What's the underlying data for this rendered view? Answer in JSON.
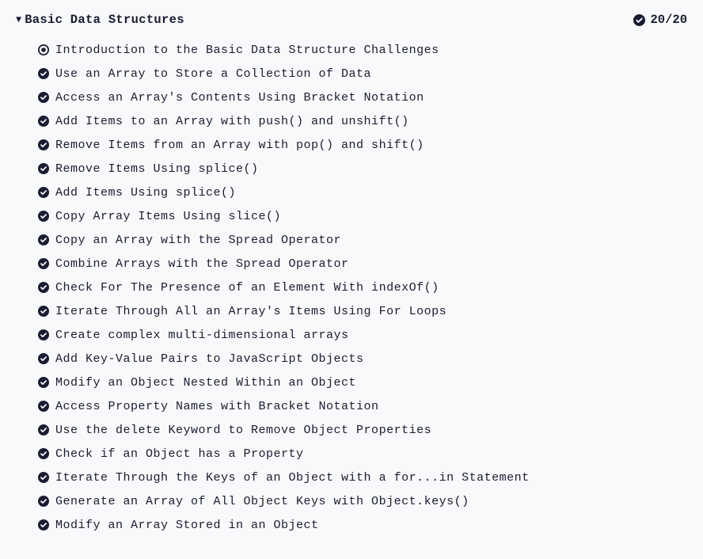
{
  "section": {
    "title": "Basic Data Structures",
    "progress": "20/20",
    "caret": "▼",
    "challenges": [
      {
        "type": "intro",
        "label": "Introduction to the Basic Data Structure Challenges"
      },
      {
        "type": "done",
        "label": "Use an Array to Store a Collection of Data"
      },
      {
        "type": "done",
        "label": "Access an Array's Contents Using Bracket Notation"
      },
      {
        "type": "done",
        "label": "Add Items to an Array with push() and unshift()"
      },
      {
        "type": "done",
        "label": "Remove Items from an Array with pop() and shift()"
      },
      {
        "type": "done",
        "label": "Remove Items Using splice()"
      },
      {
        "type": "done",
        "label": "Add Items Using splice()"
      },
      {
        "type": "done",
        "label": "Copy Array Items Using slice()"
      },
      {
        "type": "done",
        "label": "Copy an Array with the Spread Operator"
      },
      {
        "type": "done",
        "label": "Combine Arrays with the Spread Operator"
      },
      {
        "type": "done",
        "label": "Check For The Presence of an Element With indexOf()"
      },
      {
        "type": "done",
        "label": "Iterate Through All an Array's Items Using For Loops"
      },
      {
        "type": "done",
        "label": "Create complex multi-dimensional arrays"
      },
      {
        "type": "done",
        "label": "Add Key-Value Pairs to JavaScript Objects"
      },
      {
        "type": "done",
        "label": "Modify an Object Nested Within an Object"
      },
      {
        "type": "done",
        "label": "Access Property Names with Bracket Notation"
      },
      {
        "type": "done",
        "label": "Use the delete Keyword to Remove Object Properties"
      },
      {
        "type": "done",
        "label": "Check if an Object has a Property"
      },
      {
        "type": "done",
        "label": "Iterate Through the Keys of an Object with a for...in Statement"
      },
      {
        "type": "done",
        "label": "Generate an Array of All Object Keys with Object.keys()"
      },
      {
        "type": "done",
        "label": "Modify an Array Stored in an Object"
      }
    ]
  }
}
